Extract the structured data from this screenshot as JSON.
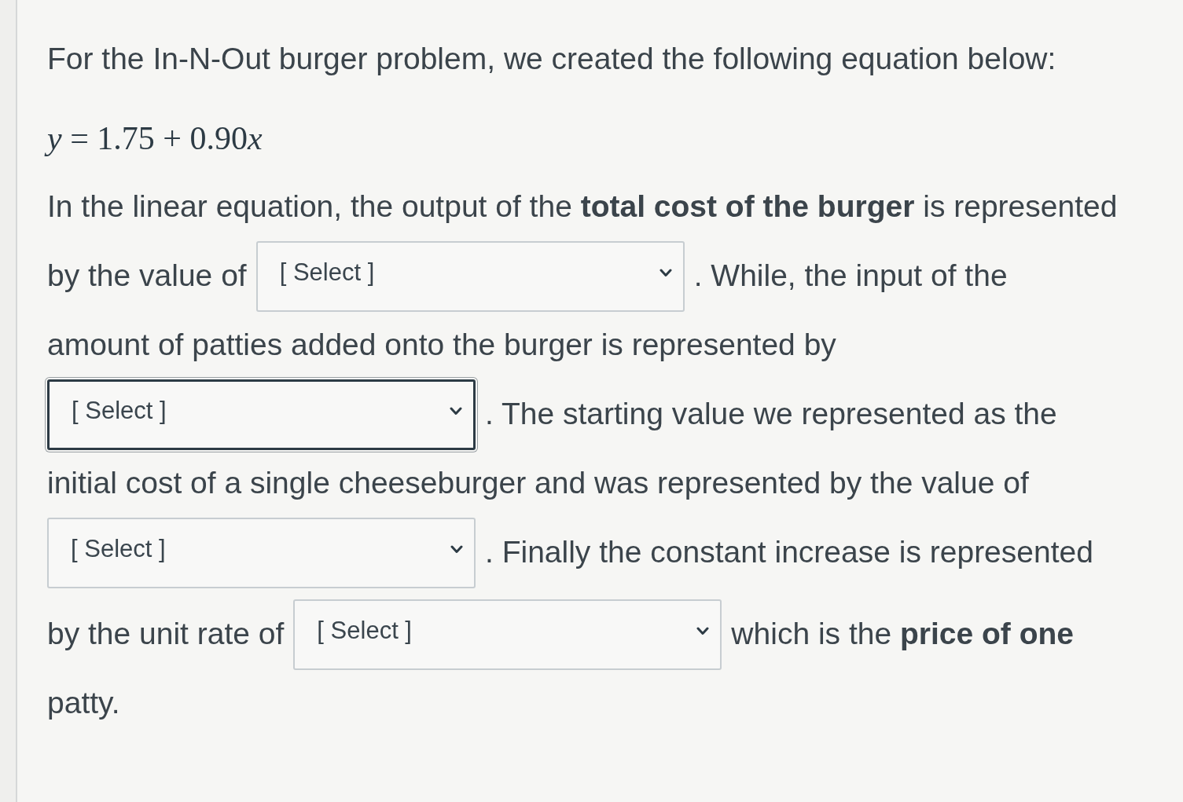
{
  "question": {
    "intro": "For the In-N-Out burger problem, we created the following equation below:",
    "equation": [
      {
        "kind": "variable",
        "text": "y"
      },
      {
        "kind": "plain",
        "text": " = 1.75 + 0.90"
      },
      {
        "kind": "variable",
        "text": "x"
      }
    ],
    "lines": [
      [
        {
          "kind": "text",
          "text": "In the linear equation, the output of the **total cost of the burger** is represented"
        }
      ],
      [
        {
          "kind": "text",
          "text": "by the value of"
        },
        {
          "kind": "select",
          "value": "[ Select ]",
          "focused": false
        },
        {
          "kind": "text",
          "text": ". While, the input of the"
        }
      ],
      [
        {
          "kind": "text",
          "text": "amount of patties added onto the burger is represented by"
        }
      ],
      [
        {
          "kind": "select",
          "value": "[ Select ]",
          "focused": true
        },
        {
          "kind": "text",
          "text": ". The starting value we represented as the"
        }
      ],
      [
        {
          "kind": "text",
          "text": "initial cost of a single cheeseburger and was represented by the value of"
        }
      ],
      [
        {
          "kind": "select",
          "value": "[ Select ]",
          "focused": false
        },
        {
          "kind": "text",
          "text": ". Finally the constant increase is represented"
        }
      ],
      [
        {
          "kind": "text",
          "text": "by the unit rate of"
        },
        {
          "kind": "select",
          "value": "[ Select ]",
          "focused": false
        },
        {
          "kind": "text",
          "text": "which is the **price of one**"
        }
      ],
      [
        {
          "kind": "text",
          "text": "patty."
        }
      ]
    ]
  }
}
